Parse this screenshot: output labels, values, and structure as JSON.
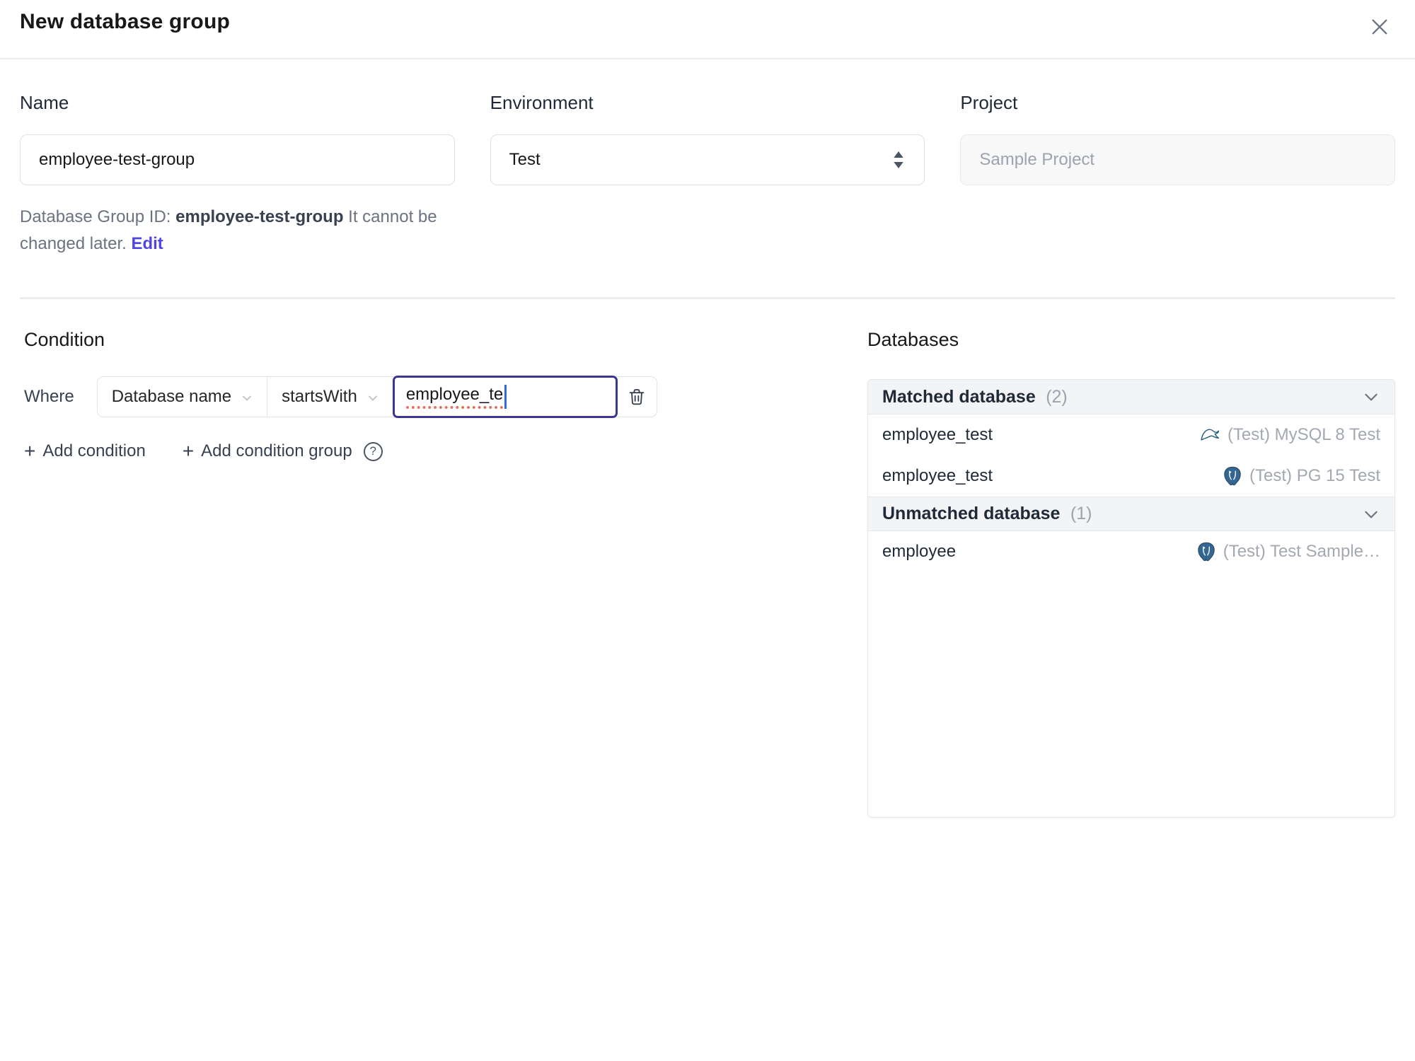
{
  "header": {
    "title": "New database group"
  },
  "form": {
    "name": {
      "label": "Name",
      "value": "employee-test-group"
    },
    "environment": {
      "label": "Environment",
      "value": "Test"
    },
    "project": {
      "label": "Project",
      "value": "Sample Project"
    },
    "id_note": {
      "prefix": "Database Group ID: ",
      "id": "employee-test-group",
      "suffix": " It cannot be changed later. ",
      "edit_label": "Edit"
    }
  },
  "condition": {
    "heading": "Condition",
    "where_label": "Where",
    "field_selected": "Database name",
    "operator_selected": "startsWith",
    "value": "employee_te",
    "add_condition_label": "Add condition",
    "add_condition_group_label": "Add condition group",
    "help_glyph": "?",
    "plus_glyph": "+"
  },
  "databases": {
    "heading": "Databases",
    "groups": [
      {
        "title": "Matched database",
        "count": "(2)",
        "rows": [
          {
            "name": "employee_test",
            "engine": "mysql",
            "instance": "(Test) MySQL 8 Test"
          },
          {
            "name": "employee_test",
            "engine": "postgresql",
            "instance": "(Test) PG 15 Test"
          }
        ]
      },
      {
        "title": "Unmatched database",
        "count": "(1)",
        "rows": [
          {
            "name": "employee",
            "engine": "postgresql",
            "instance": "(Test) Test Sample…"
          }
        ]
      }
    ]
  },
  "colors": {
    "accent_link": "#4f46e5",
    "focus_border": "#3b3690",
    "spellcheck_underline": "#e05a4a",
    "panel_header_bg": "#f3f4f6",
    "border": "#e5e7eb",
    "muted_text": "#9ca3af",
    "mysql_icon": "#1f5c75",
    "postgresql_icon": "#336791"
  },
  "icons": [
    "close-icon",
    "updown-chevrons-icon",
    "chevron-down-icon",
    "trash-icon",
    "plus-icon",
    "help-icon",
    "mysql-icon",
    "postgresql-icon",
    "text-caret"
  ]
}
